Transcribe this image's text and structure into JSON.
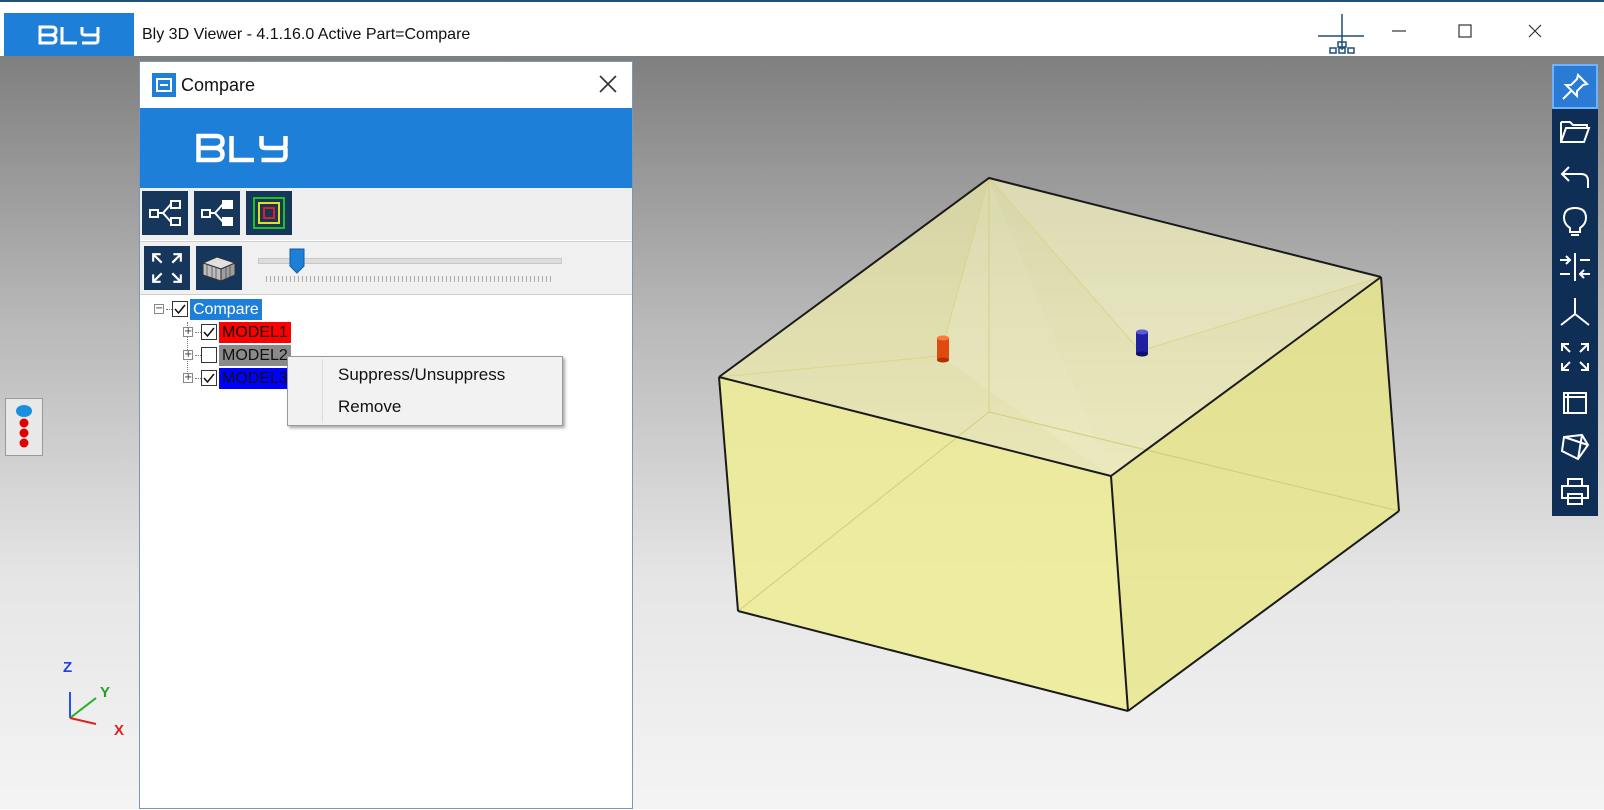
{
  "app": {
    "logo_text": "BLY",
    "window_title": "Bly 3D Viewer - 4.1.16.0 Active Part=Compare"
  },
  "window_controls": [
    "minimize-icon",
    "maximize-icon",
    "close-icon"
  ],
  "compare_panel": {
    "title": "Compare",
    "banner_logo": "BLY",
    "toolbar1": [
      "tree-expand-icon",
      "tree-collapse-icon",
      "layers-icon"
    ],
    "toolbar2": [
      "fit-view-icon",
      "section-box-icon"
    ],
    "transparency_slider": {
      "value": 0.13
    },
    "tree": {
      "root": {
        "label": "Compare",
        "checked": true
      },
      "children": [
        {
          "label": "MODEL1",
          "checked": true,
          "color": "#ff0000"
        },
        {
          "label": "MODEL2",
          "checked": false,
          "color": "#8a8a8a"
        },
        {
          "label": "MODEL3",
          "checked": true,
          "color": "#0000ff"
        }
      ]
    }
  },
  "context_menu": {
    "items": [
      "Suppress/Unsuppress",
      "Remove"
    ]
  },
  "right_toolbar": [
    "pin-icon",
    "open-folder-icon",
    "undo-icon",
    "lightbulb-icon",
    "compare-icon",
    "axis-icon",
    "fit-view-icon",
    "view-box-icon",
    "shaded-view-icon",
    "print-icon"
  ],
  "axis": {
    "z": "Z",
    "y": "Y",
    "x": "X"
  },
  "colors": {
    "brand": "#1e7fd8",
    "toolbar_dark": "#0f2e55",
    "model_fill": "#f0ee9a",
    "model1": "#ff0000",
    "model3": "#0000ff"
  }
}
